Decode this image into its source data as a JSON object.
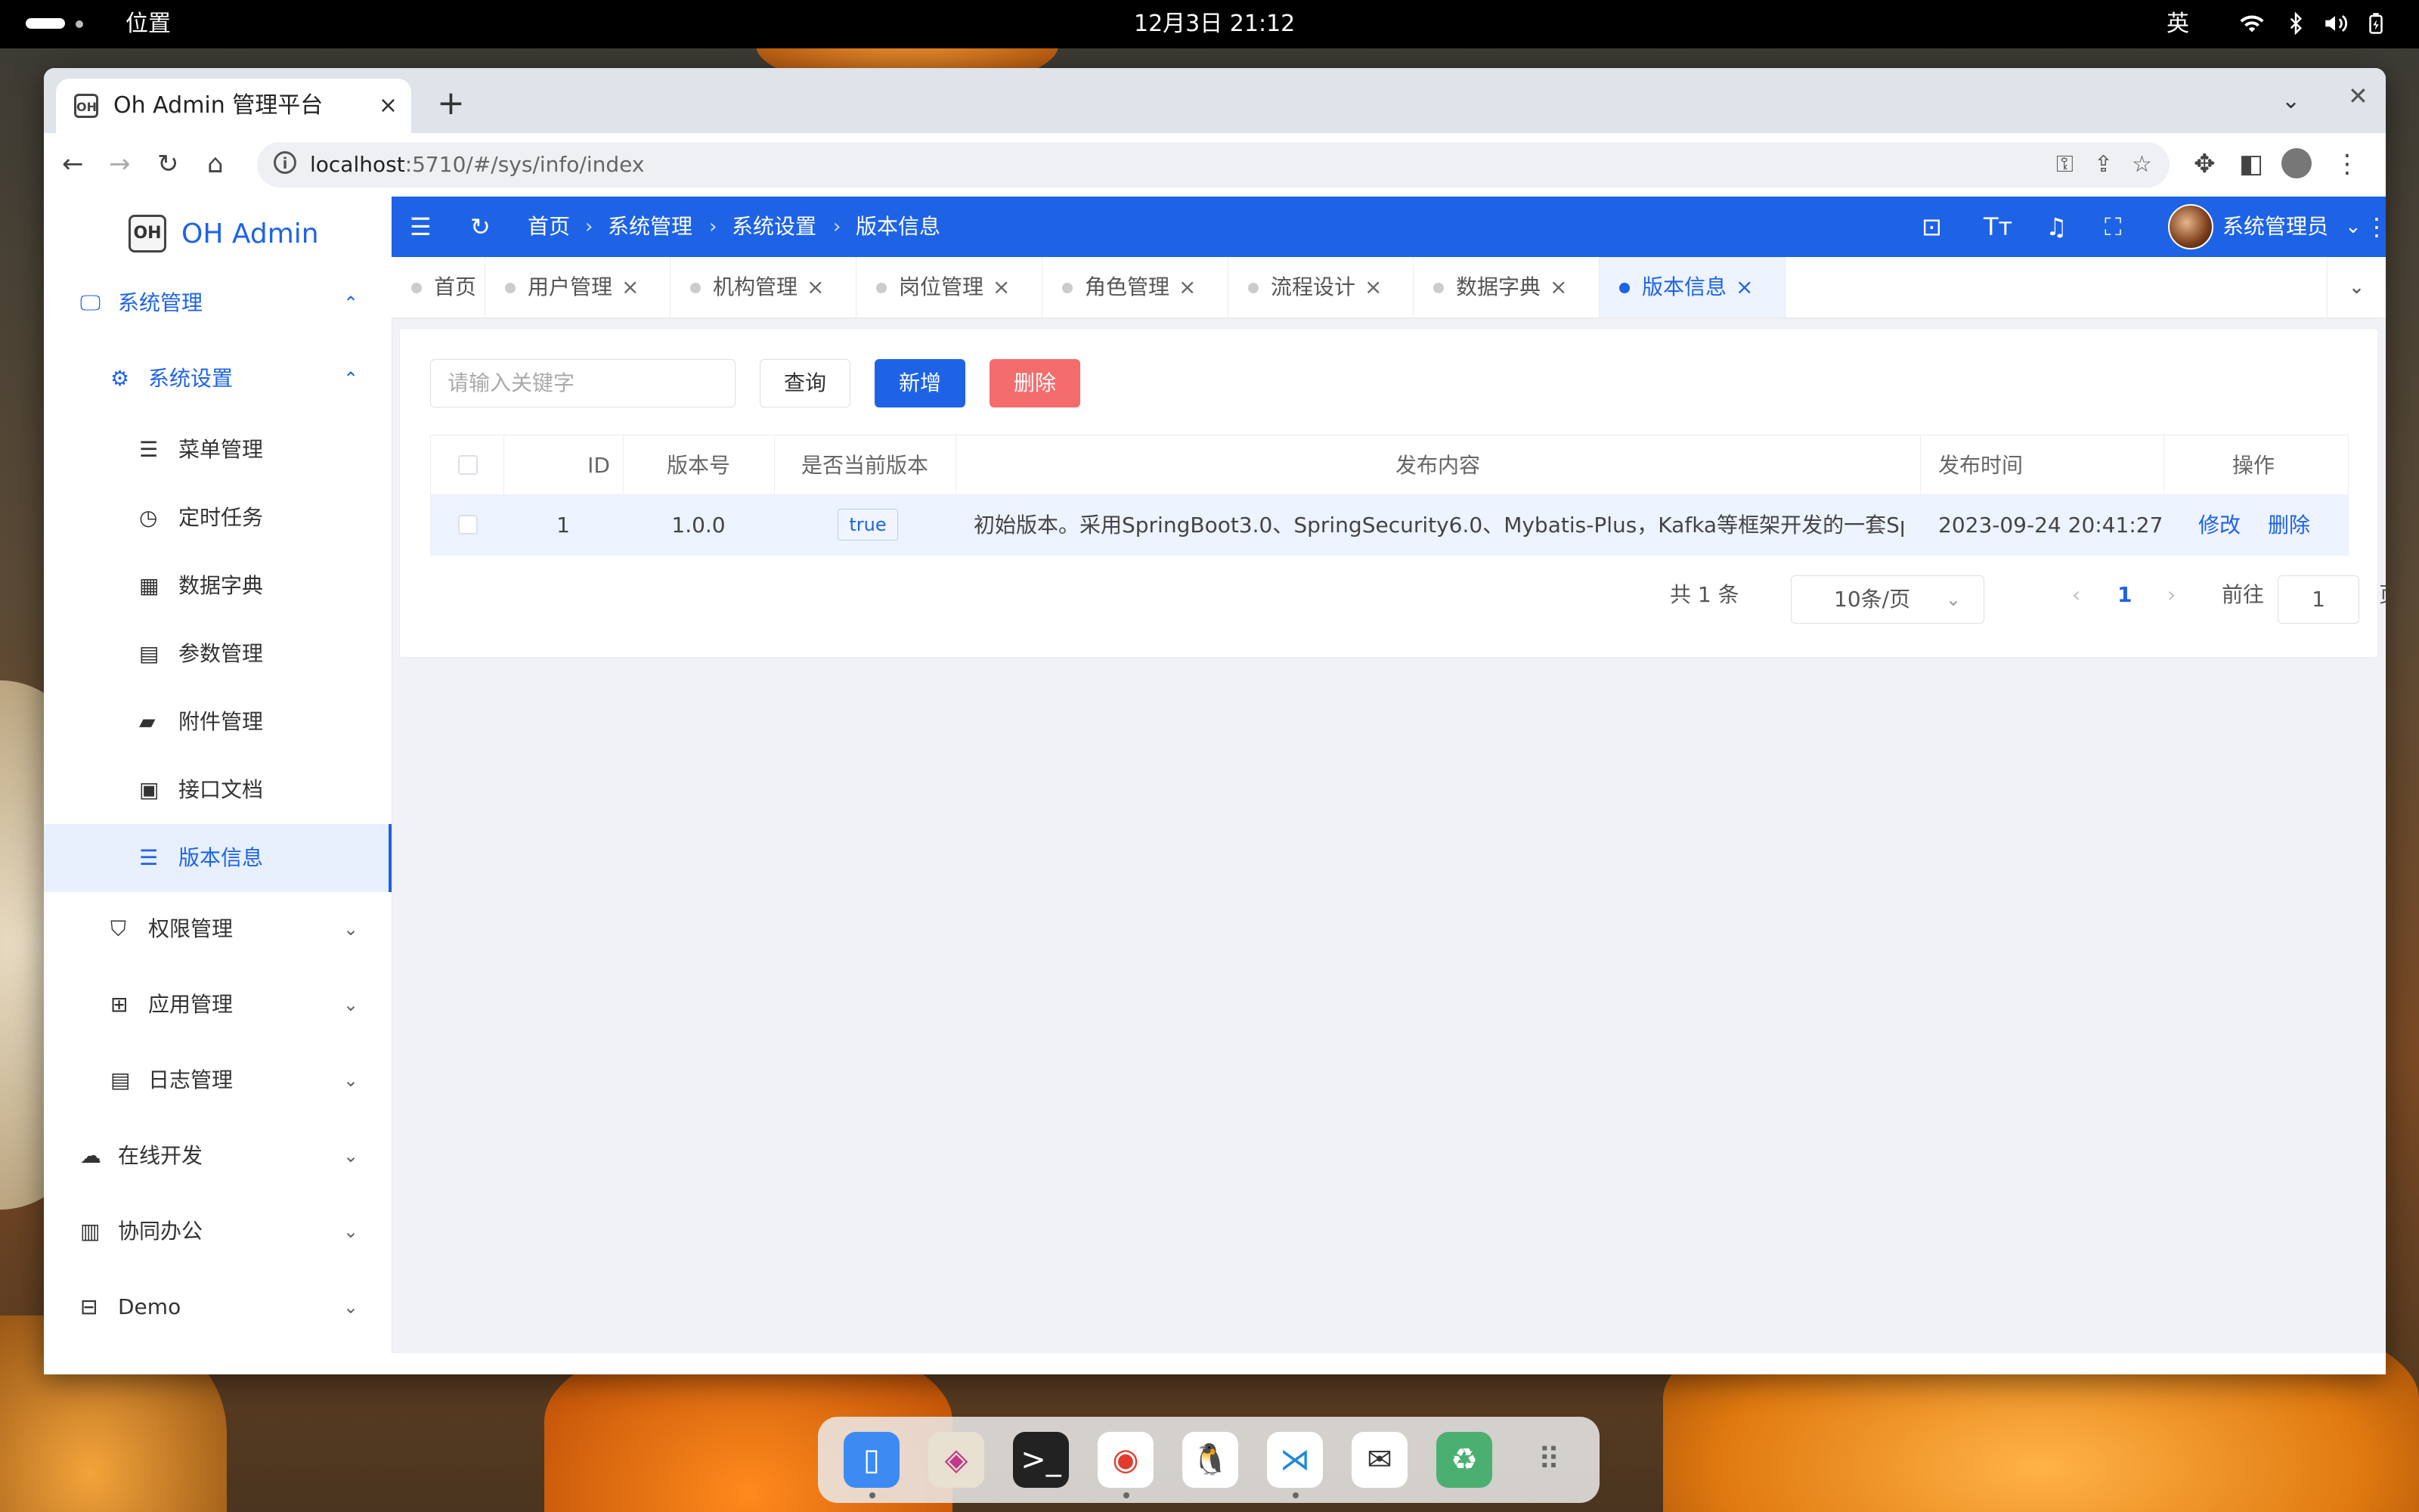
{
  "system_bar": {
    "location": "位置",
    "datetime": "12月3日  21:12",
    "ime": "英",
    "tray_icons": [
      "wifi-icon",
      "bluetooth-icon",
      "volume-icon",
      "battery-icon"
    ]
  },
  "browser": {
    "tab_title": "Oh Admin 管理平台",
    "favicon_text": "OH",
    "tab_close": "×",
    "new_tab": "+",
    "url_host": "localhost",
    "url_rest": ":5710/#/sys/info/index"
  },
  "app": {
    "logo_mark": "OH",
    "logo_name": "OH Admin",
    "sidebar": {
      "sys_manage": "系统管理",
      "sys_settings": "系统设置",
      "items": [
        "菜单管理",
        "定时任务",
        "数据字典",
        "参数管理",
        "附件管理",
        "接口文档",
        "版本信息"
      ],
      "groups": [
        "权限管理",
        "应用管理",
        "日志管理"
      ],
      "top": [
        "在线开发",
        "协同办公",
        "Demo"
      ]
    },
    "breadcrumb": [
      "首页",
      "系统管理",
      "系统设置",
      "版本信息"
    ],
    "user_name": "系统管理员",
    "tags": [
      "首页",
      "用户管理",
      "机构管理",
      "岗位管理",
      "角色管理",
      "流程设计",
      "数据字典",
      "版本信息"
    ],
    "tag_close": "×",
    "search_placeholder": "请输入关键字",
    "buttons": {
      "query": "查询",
      "add": "新增",
      "delete": "删除"
    },
    "table": {
      "headers": [
        "ID",
        "版本号",
        "是否当前版本",
        "发布内容",
        "发布时间",
        "操作"
      ],
      "rows": [
        {
          "id": "1",
          "version": "1.0.0",
          "current": "true",
          "content": "初始版本。采用SpringBoot3.0、SpringSecurity6.0、Mybatis-Plus，Kafka等框架开发的一套Spri…",
          "time": "2023-09-24 20:41:27",
          "edit": "修改",
          "delete": "删除"
        }
      ]
    },
    "pagination": {
      "total": "共 1 条",
      "page_size": "10条/页",
      "current_page": "1",
      "goto_label": "前往",
      "goto_value": "1",
      "page_suffix": "页"
    }
  },
  "dock_apps": [
    "file-manager-icon",
    "app-store-icon",
    "terminal-icon",
    "chrome-icon",
    "qq-icon",
    "vscode-icon",
    "mail-icon",
    "trash-icon",
    "app-grid-icon"
  ]
}
